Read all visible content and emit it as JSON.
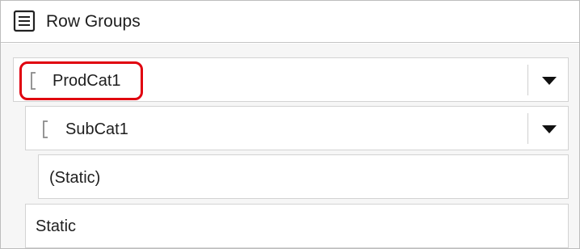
{
  "header": {
    "title": "Row Groups",
    "icon": "list-icon"
  },
  "groups": [
    {
      "label": "ProdCat1",
      "icon": "group-bracket-icon",
      "has_dropdown": true,
      "highlighted": true
    },
    {
      "label": "SubCat1",
      "icon": "group-bracket-icon",
      "has_dropdown": true,
      "highlighted": false
    },
    {
      "label": "(Static)",
      "has_dropdown": false
    },
    {
      "label": "Static",
      "has_dropdown": false
    }
  ],
  "colors": {
    "highlight": "#e0000f",
    "border": "#d3d3d3",
    "panel_bg": "#f6f6f6"
  }
}
